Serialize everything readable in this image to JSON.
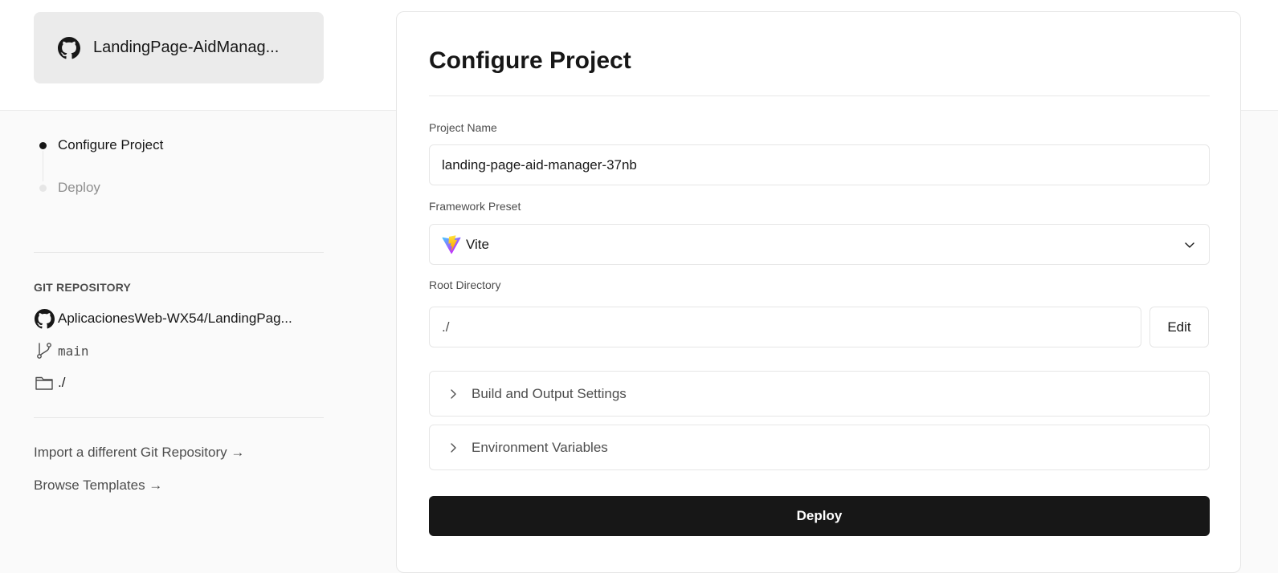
{
  "repo_card": {
    "name": "LandingPage-AidManag..."
  },
  "steps": [
    {
      "label": "Configure Project",
      "state": "active"
    },
    {
      "label": "Deploy",
      "state": "inactive"
    }
  ],
  "git": {
    "title": "GIT REPOSITORY",
    "repository": "AplicacionesWeb-WX54/LandingPag...",
    "branch": "main",
    "directory": "./"
  },
  "links": {
    "import": "Import a different Git Repository →",
    "templates": "Browse Templates →"
  },
  "configure": {
    "title": "Configure Project",
    "project_name_label": "Project Name",
    "project_name_value": "landing-page-aid-manager-37nb",
    "framework_label": "Framework Preset",
    "framework_value": "Vite",
    "root_label": "Root Directory",
    "root_value": "./",
    "edit_label": "Edit",
    "build_settings_label": "Build and Output Settings",
    "env_vars_label": "Environment Variables",
    "deploy_label": "Deploy"
  },
  "colors": {
    "primary": "#171717",
    "vite_purple": "#A259FF",
    "vite_yellow": "#FFC517"
  }
}
